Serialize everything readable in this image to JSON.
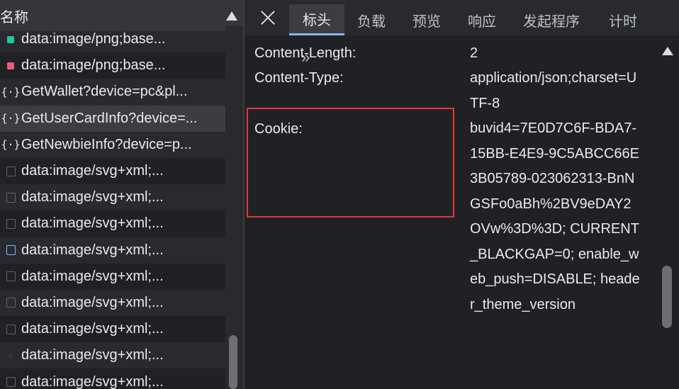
{
  "left": {
    "header_title": "名称",
    "rows": [
      {
        "icon": "green-square-icon",
        "text": "data:image/png;base..."
      },
      {
        "icon": "red-square-icon",
        "text": "data:image/png;base..."
      },
      {
        "icon": "json-braces-icon",
        "text": "GetWallet?device=pc&pl..."
      },
      {
        "icon": "json-braces-icon",
        "text": "GetUserCardInfo?device=..."
      },
      {
        "icon": "json-braces-icon",
        "text": "GetNewbieInfo?device=p..."
      },
      {
        "icon": "svg-file-icon",
        "text": "data:image/svg+xml;..."
      },
      {
        "icon": "svg-file-icon",
        "text": "data:image/svg+xml;..."
      },
      {
        "icon": "svg-file-icon",
        "text": "data:image/svg+xml;..."
      },
      {
        "icon": "svg-file-icon",
        "text": "data:image/svg+xml;..."
      },
      {
        "icon": "svg-file-icon",
        "text": "data:image/svg+xml;..."
      },
      {
        "icon": "svg-file-icon",
        "text": "data:image/svg+xml;..."
      },
      {
        "icon": "svg-file-icon",
        "text": "data:image/svg+xml;..."
      },
      {
        "icon": "star-icon",
        "text": "data:image/svg+xml;..."
      },
      {
        "icon": "svg-file-icon",
        "text": "data:image/svg+xml;..."
      }
    ]
  },
  "tabs": [
    "标头",
    "负载",
    "预览",
    "响应",
    "发起程序",
    "计时"
  ],
  "headers": {
    "content_length_name": "Content-Length:",
    "content_length_value": "2",
    "content_type_name": "Content-Type:",
    "content_type_value": "application/json;charset=UTF-8",
    "cookie_name": "Cookie:",
    "cookie_value": "buvid4=7E0D7C6F-BDA7-15BB-E4E9-9C5ABCC66E3B05789-023062313-BnNGSFo0aBh%2BV9eDAY2OVw%3D%3D; CURRENT_BLACKGAP=0; enable_web_push=DISABLE; header_theme_version"
  },
  "icons": {
    "close": "close-icon",
    "expand": "double-chevron-right-icon"
  },
  "colors": {
    "accent": "#8ab4f8",
    "highlight_border": "#e53935",
    "json_icon": "#e8eaed",
    "green": "#1fc7a3",
    "red": "#ef5a7a"
  }
}
